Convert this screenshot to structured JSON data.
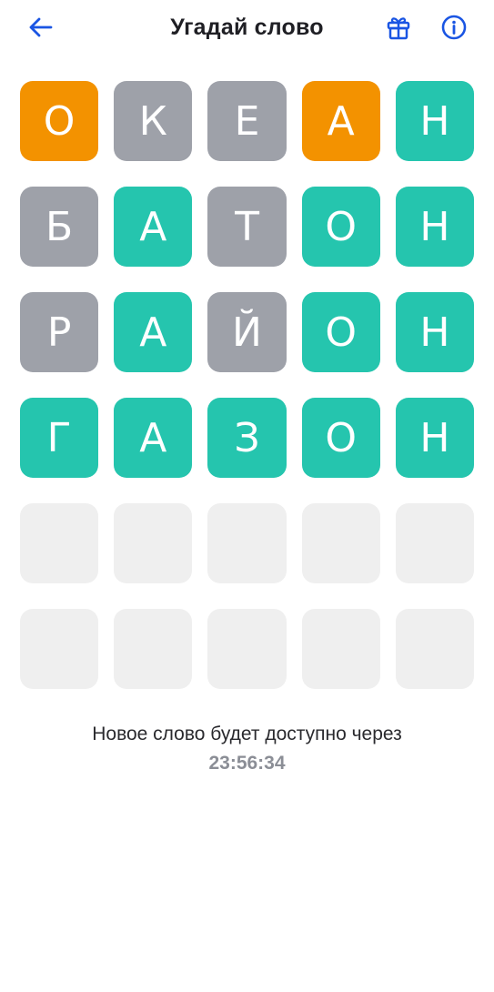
{
  "header": {
    "title": "Угадай слово",
    "back_icon": "arrow-left-icon",
    "gift_icon": "gift-icon",
    "info_icon": "info-icon"
  },
  "colors": {
    "accent": "#1a55e3",
    "absent": "#9ea1a9",
    "present": "#f39200",
    "correct": "#25c5ae",
    "empty": "#efefef"
  },
  "board": {
    "rows": [
      {
        "letters": [
          "О",
          "К",
          "Е",
          "А",
          "Н"
        ],
        "states": [
          "present",
          "absent",
          "absent",
          "present",
          "correct"
        ]
      },
      {
        "letters": [
          "Б",
          "А",
          "Т",
          "О",
          "Н"
        ],
        "states": [
          "absent",
          "correct",
          "absent",
          "correct",
          "correct"
        ]
      },
      {
        "letters": [
          "Р",
          "А",
          "Й",
          "О",
          "Н"
        ],
        "states": [
          "absent",
          "correct",
          "absent",
          "correct",
          "correct"
        ]
      },
      {
        "letters": [
          "Г",
          "А",
          "З",
          "О",
          "Н"
        ],
        "states": [
          "correct",
          "correct",
          "correct",
          "correct",
          "correct"
        ]
      },
      {
        "letters": [
          "",
          "",
          "",
          "",
          ""
        ],
        "states": [
          "empty",
          "empty",
          "empty",
          "empty",
          "empty"
        ]
      },
      {
        "letters": [
          "",
          "",
          "",
          "",
          ""
        ],
        "states": [
          "empty",
          "empty",
          "empty",
          "empty",
          "empty"
        ]
      }
    ]
  },
  "footer": {
    "message": "Новое слово будет доступно через",
    "timer": "23:56:34"
  }
}
